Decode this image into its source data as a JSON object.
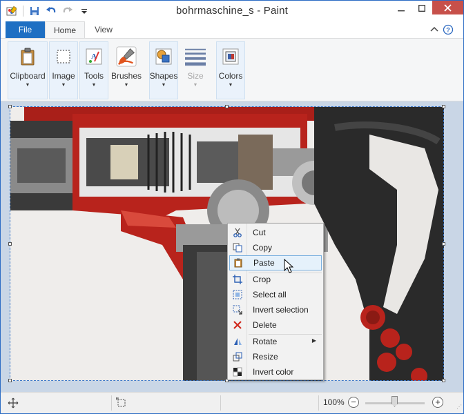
{
  "window": {
    "title": "bohrmaschine_s - Paint"
  },
  "qat": {
    "icons": [
      "paint-app-icon",
      "save-icon",
      "undo-icon",
      "redo-icon",
      "customize-qat-icon"
    ]
  },
  "tabs": [
    {
      "label": "File"
    },
    {
      "label": "Home"
    },
    {
      "label": "View"
    }
  ],
  "ribbon": {
    "groups": [
      {
        "label": "Clipboard",
        "icon": "clipboard-icon"
      },
      {
        "label": "Image",
        "icon": "select-icon"
      },
      {
        "label": "Tools",
        "icon": "tools-icon"
      },
      {
        "label": "Brushes",
        "icon": "brush-icon"
      },
      {
        "label": "Shapes",
        "icon": "shapes-icon"
      },
      {
        "label": "Size",
        "icon": "size-icon",
        "disabled": true
      },
      {
        "label": "Colors",
        "icon": "colors-icon"
      }
    ]
  },
  "context_menu": {
    "items": [
      {
        "label": "Cut",
        "icon": "scissors-icon"
      },
      {
        "label": "Copy",
        "icon": "copy-icon"
      },
      {
        "label": "Paste",
        "icon": "paste-icon",
        "hovered": true
      },
      {
        "label": "Crop",
        "icon": "crop-icon"
      },
      {
        "label": "Select all",
        "icon": "select-all-icon"
      },
      {
        "label": "Invert selection",
        "icon": "invert-selection-icon"
      },
      {
        "label": "Delete",
        "icon": "delete-icon"
      },
      {
        "label": "Rotate",
        "icon": "rotate-icon",
        "submenu": true
      },
      {
        "label": "Resize",
        "icon": "resize-icon"
      },
      {
        "label": "Invert color",
        "icon": "invert-color-icon"
      }
    ]
  },
  "statusbar": {
    "zoom": "100%",
    "zoom_out": "−",
    "zoom_in": "+"
  },
  "colors": {
    "accent": "#1e6fc3",
    "canvas_bg": "#c9d6e6",
    "drill_red": "#b8231c"
  }
}
